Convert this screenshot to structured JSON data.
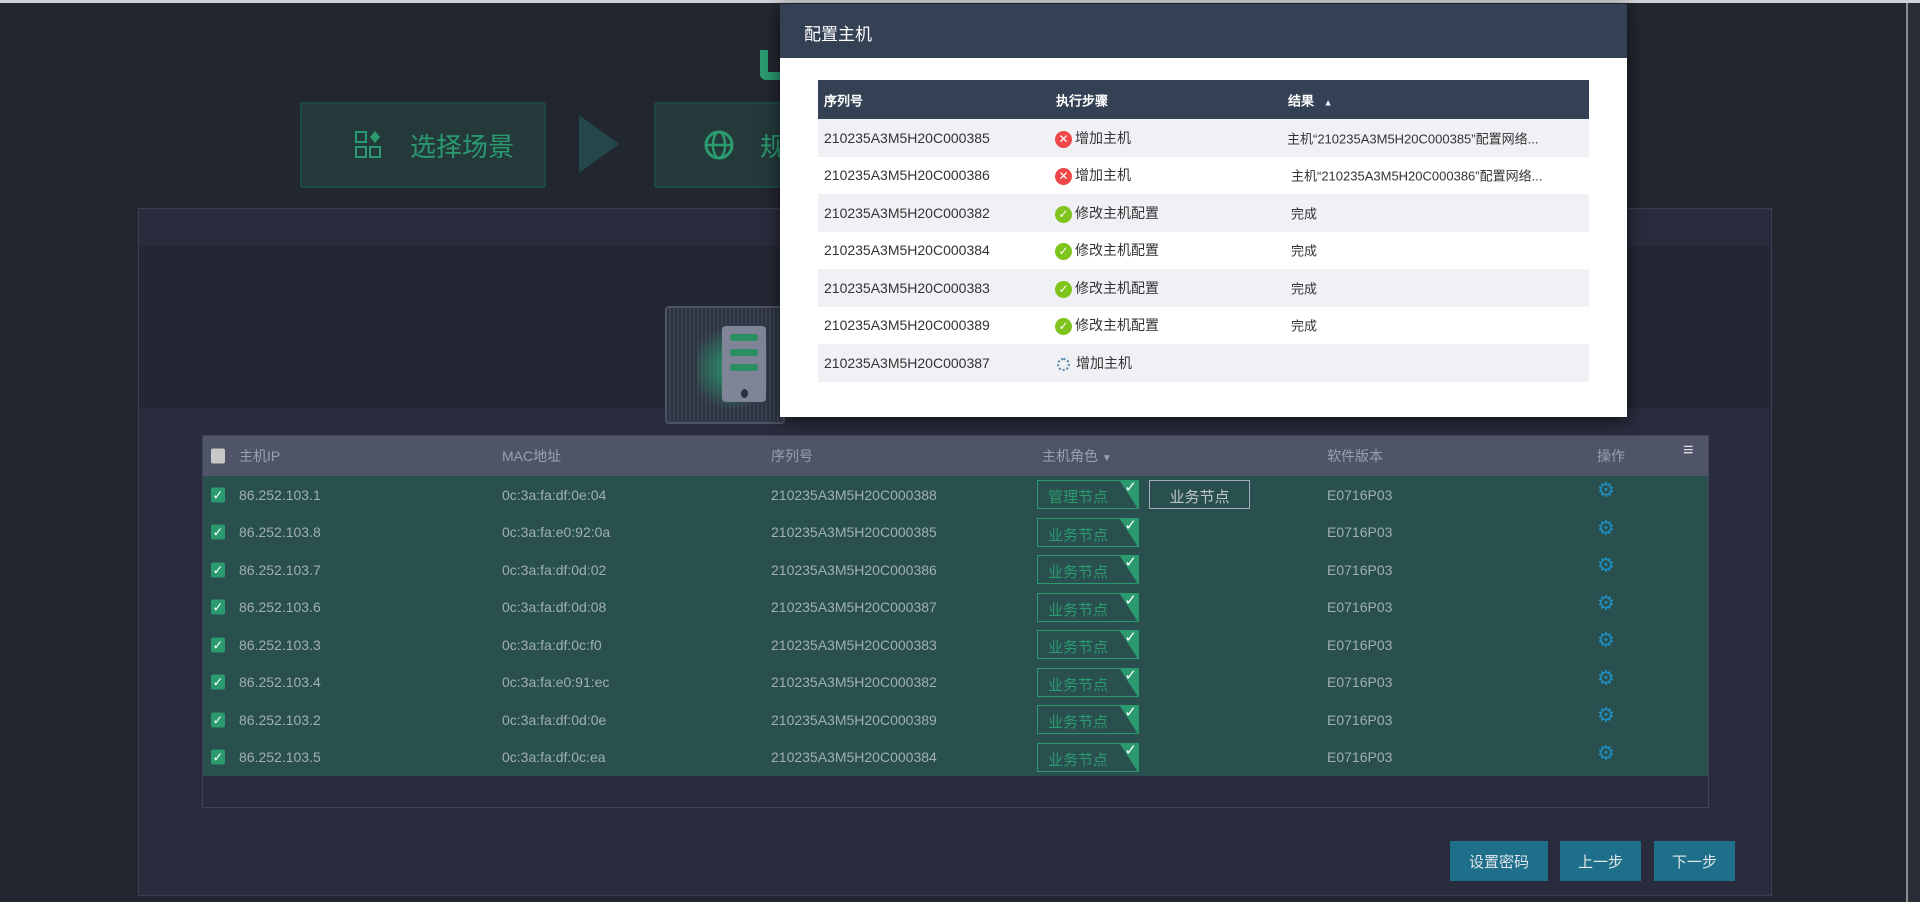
{
  "steps": [
    {
      "label": "选择场景",
      "icon": "scene-grid-icon"
    },
    {
      "label": "规",
      "icon": "globe-icon"
    }
  ],
  "hosts": {
    "columns": {
      "ip": "主机IP",
      "mac": "MAC地址",
      "serial": "序列号",
      "role": "主机角色",
      "version": "软件版本",
      "action": "操作"
    },
    "rows": [
      {
        "ip": "86.252.103.1",
        "mac": "0c:3a:fa:df:0e:04",
        "serial": "210235A3M5H20C000388",
        "role": "管理节点",
        "alt_role": "业务节点",
        "version": "E0716P03"
      },
      {
        "ip": "86.252.103.8",
        "mac": "0c:3a:fa:e0:92:0a",
        "serial": "210235A3M5H20C000385",
        "role": "业务节点",
        "version": "E0716P03"
      },
      {
        "ip": "86.252.103.7",
        "mac": "0c:3a:fa:df:0d:02",
        "serial": "210235A3M5H20C000386",
        "role": "业务节点",
        "version": "E0716P03"
      },
      {
        "ip": "86.252.103.6",
        "mac": "0c:3a:fa:df:0d:08",
        "serial": "210235A3M5H20C000387",
        "role": "业务节点",
        "version": "E0716P03"
      },
      {
        "ip": "86.252.103.3",
        "mac": "0c:3a:fa:df:0c:f0",
        "serial": "210235A3M5H20C000383",
        "role": "业务节点",
        "version": "E0716P03"
      },
      {
        "ip": "86.252.103.4",
        "mac": "0c:3a:fa:e0:91:ec",
        "serial": "210235A3M5H20C000382",
        "role": "业务节点",
        "version": "E0716P03"
      },
      {
        "ip": "86.252.103.2",
        "mac": "0c:3a:fa:df:0d:0e",
        "serial": "210235A3M5H20C000389",
        "role": "业务节点",
        "version": "E0716P03"
      },
      {
        "ip": "86.252.103.5",
        "mac": "0c:3a:fa:df:0c:ea",
        "serial": "210235A3M5H20C000384",
        "role": "业务节点",
        "version": "E0716P03"
      }
    ]
  },
  "buttons": {
    "set_password": "设置密码",
    "prev": "上一步",
    "next": "下一步"
  },
  "modal": {
    "title": "配置主机",
    "columns": {
      "serial": "序列号",
      "step": "执行步骤",
      "result": "结果"
    },
    "rows": [
      {
        "serial": "210235A3M5H20C000385",
        "status": "fail",
        "step": "增加主机",
        "result": "主机“210235A3M5H20C000385”配置网络..."
      },
      {
        "serial": "210235A3M5H20C000386",
        "status": "fail",
        "step": "增加主机",
        "result": "主机“210235A3M5H20C000386”配置网络..."
      },
      {
        "serial": "210235A3M5H20C000382",
        "status": "ok",
        "step": "修改主机配置",
        "result": "完成"
      },
      {
        "serial": "210235A3M5H20C000384",
        "status": "ok",
        "step": "修改主机配置",
        "result": "完成"
      },
      {
        "serial": "210235A3M5H20C000383",
        "status": "ok",
        "step": "修改主机配置",
        "result": "完成"
      },
      {
        "serial": "210235A3M5H20C000389",
        "status": "ok",
        "step": "修改主机配置",
        "result": "完成"
      },
      {
        "serial": "210235A3M5H20C000387",
        "status": "running",
        "step": "增加主机",
        "result": ""
      }
    ]
  },
  "colors": {
    "accent": "#2b9a6f",
    "button": "#1d6f8a",
    "modal_header": "#344054"
  }
}
